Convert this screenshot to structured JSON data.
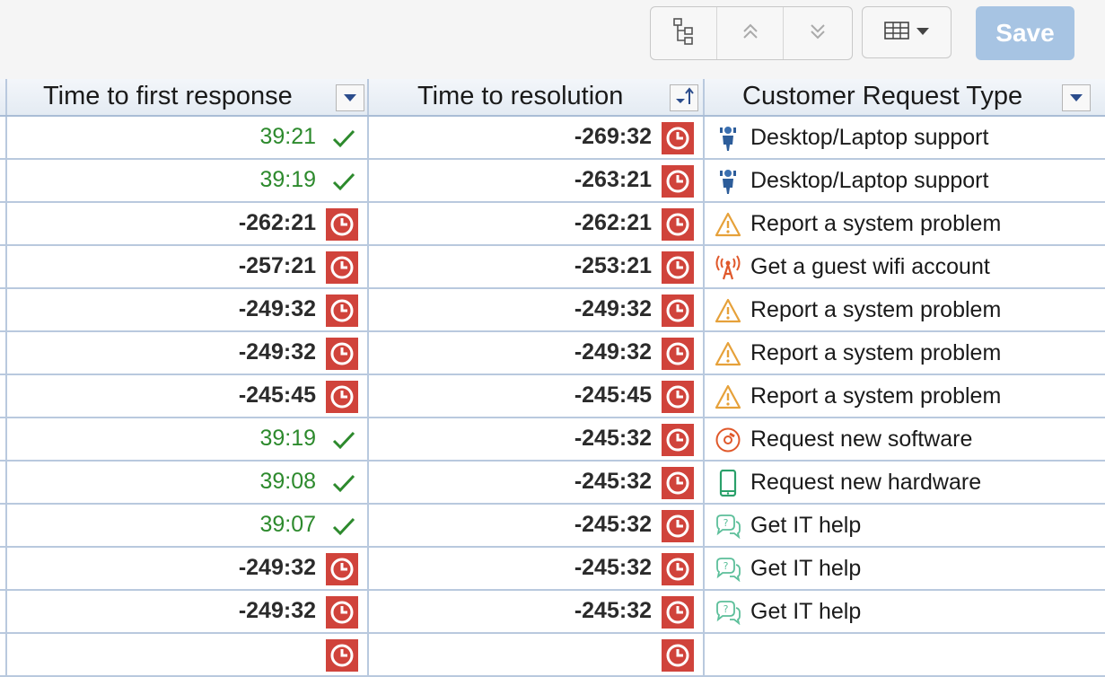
{
  "toolbar": {
    "save_label": "Save",
    "buttons": [
      "hierarchy-icon",
      "collapse-all-icon",
      "expand-all-icon",
      "table-view-icon"
    ]
  },
  "table": {
    "columns": [
      {
        "label": "Time to first response",
        "sort": "dropdown"
      },
      {
        "label": "Time to resolution",
        "sort": "sorted-ascending"
      },
      {
        "label": "Customer Request Type",
        "sort": "dropdown"
      }
    ],
    "rows": [
      {
        "first_response": "39:21",
        "first_status": "met",
        "resolution": "-269:32",
        "resolution_status": "breached",
        "request_type": "Desktop/Laptop support",
        "type_icon": "support-person-icon"
      },
      {
        "first_response": "39:19",
        "first_status": "met",
        "resolution": "-263:21",
        "resolution_status": "breached",
        "request_type": "Desktop/Laptop support",
        "type_icon": "support-person-icon"
      },
      {
        "first_response": "-262:21",
        "first_status": "breached",
        "resolution": "-262:21",
        "resolution_status": "breached",
        "request_type": "Report a system problem",
        "type_icon": "warning-icon"
      },
      {
        "first_response": "-257:21",
        "first_status": "breached",
        "resolution": "-253:21",
        "resolution_status": "breached",
        "request_type": "Get a guest wifi account",
        "type_icon": "wifi-tower-icon"
      },
      {
        "first_response": "-249:32",
        "first_status": "breached",
        "resolution": "-249:32",
        "resolution_status": "breached",
        "request_type": "Report a system problem",
        "type_icon": "warning-icon"
      },
      {
        "first_response": "-249:32",
        "first_status": "breached",
        "resolution": "-249:32",
        "resolution_status": "breached",
        "request_type": "Report a system problem",
        "type_icon": "warning-icon"
      },
      {
        "first_response": "-245:45",
        "first_status": "breached",
        "resolution": "-245:45",
        "resolution_status": "breached",
        "request_type": "Report a system problem",
        "type_icon": "warning-icon"
      },
      {
        "first_response": "39:19",
        "first_status": "met",
        "resolution": "-245:32",
        "resolution_status": "breached",
        "request_type": "Request new software",
        "type_icon": "software-disc-icon"
      },
      {
        "first_response": "39:08",
        "first_status": "met",
        "resolution": "-245:32",
        "resolution_status": "breached",
        "request_type": "Request new hardware",
        "type_icon": "phone-hardware-icon"
      },
      {
        "first_response": "39:07",
        "first_status": "met",
        "resolution": "-245:32",
        "resolution_status": "breached",
        "request_type": "Get IT help",
        "type_icon": "help-chat-icon"
      },
      {
        "first_response": "-249:32",
        "first_status": "breached",
        "resolution": "-245:32",
        "resolution_status": "breached",
        "request_type": "Get IT help",
        "type_icon": "help-chat-icon"
      },
      {
        "first_response": "-249:32",
        "first_status": "breached",
        "resolution": "-245:32",
        "resolution_status": "breached",
        "request_type": "Get IT help",
        "type_icon": "help-chat-icon"
      }
    ]
  },
  "colors": {
    "ok_green": "#2d8a2d",
    "breach_red": "#d0433b",
    "save_bg": "#a7c4e3",
    "grid_line": "#b9c9de",
    "header_text": "#1a1a1a"
  }
}
